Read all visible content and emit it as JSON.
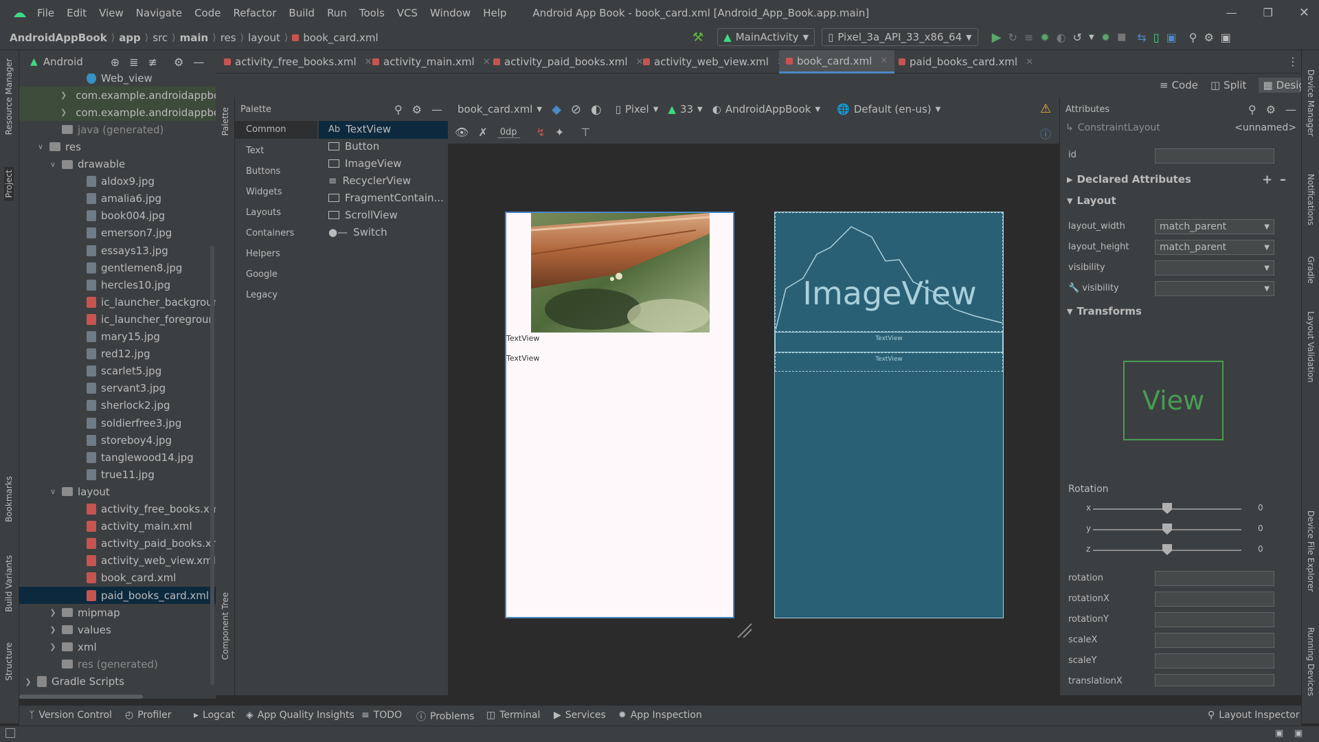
{
  "window": {
    "title": "Android App Book - book_card.xml [Android_App_Book.app.main]",
    "menu": [
      "File",
      "Edit",
      "View",
      "Navigate",
      "Code",
      "Refactor",
      "Build",
      "Run",
      "Tools",
      "VCS",
      "Window",
      "Help"
    ]
  },
  "breadcrumb": [
    "AndroidAppBook",
    "app",
    "src",
    "main",
    "res",
    "layout",
    "book_card.xml"
  ],
  "toolbar": {
    "run_config": "MainActivity",
    "device": "Pixel_3a_API_33_x86_64"
  },
  "project_panel": {
    "view_label": "Android",
    "tree": [
      {
        "label": "Web_view",
        "indent": 4,
        "kind": "class"
      },
      {
        "label": "com.example.androidappbo",
        "indent": 3,
        "kind": "package",
        "arrow": "right"
      },
      {
        "label": "com.example.androidappbo",
        "indent": 3,
        "kind": "package",
        "arrow": "right"
      },
      {
        "label": "java (generated)",
        "indent": 2,
        "kind": "folder-gen"
      },
      {
        "label": "res",
        "indent": 1,
        "kind": "folder",
        "arrow": "down"
      },
      {
        "label": "drawable",
        "indent": 2,
        "kind": "folder",
        "arrow": "down"
      },
      {
        "label": "aldox9.jpg",
        "indent": 4,
        "kind": "image"
      },
      {
        "label": "amalia6.jpg",
        "indent": 4,
        "kind": "image"
      },
      {
        "label": "book004.jpg",
        "indent": 4,
        "kind": "image"
      },
      {
        "label": "emerson7.jpg",
        "indent": 4,
        "kind": "image"
      },
      {
        "label": "essays13.jpg",
        "indent": 4,
        "kind": "image"
      },
      {
        "label": "gentlemen8.jpg",
        "indent": 4,
        "kind": "image"
      },
      {
        "label": "hercles10.jpg",
        "indent": 4,
        "kind": "image"
      },
      {
        "label": "ic_launcher_background.x",
        "indent": 4,
        "kind": "xml"
      },
      {
        "label": "ic_launcher_foreground.x",
        "indent": 4,
        "kind": "xml"
      },
      {
        "label": "mary15.jpg",
        "indent": 4,
        "kind": "image"
      },
      {
        "label": "red12.jpg",
        "indent": 4,
        "kind": "image"
      },
      {
        "label": "scarlet5.jpg",
        "indent": 4,
        "kind": "image"
      },
      {
        "label": "servant3.jpg",
        "indent": 4,
        "kind": "image"
      },
      {
        "label": "sherlock2.jpg",
        "indent": 4,
        "kind": "image"
      },
      {
        "label": "soldierfree3.jpg",
        "indent": 4,
        "kind": "image"
      },
      {
        "label": "storeboy4.jpg",
        "indent": 4,
        "kind": "image"
      },
      {
        "label": "tanglewood14.jpg",
        "indent": 4,
        "kind": "image"
      },
      {
        "label": "true11.jpg",
        "indent": 4,
        "kind": "image"
      },
      {
        "label": "layout",
        "indent": 2,
        "kind": "folder",
        "arrow": "down"
      },
      {
        "label": "activity_free_books.xml",
        "indent": 4,
        "kind": "xml"
      },
      {
        "label": "activity_main.xml",
        "indent": 4,
        "kind": "xml"
      },
      {
        "label": "activity_paid_books.xml",
        "indent": 4,
        "kind": "xml"
      },
      {
        "label": "activity_web_view.xml",
        "indent": 4,
        "kind": "xml"
      },
      {
        "label": "book_card.xml",
        "indent": 4,
        "kind": "xml"
      },
      {
        "label": "paid_books_card.xml",
        "indent": 4,
        "kind": "xml",
        "selected": true
      },
      {
        "label": "mipmap",
        "indent": 2,
        "kind": "folder",
        "arrow": "right"
      },
      {
        "label": "values",
        "indent": 2,
        "kind": "folder",
        "arrow": "right"
      },
      {
        "label": "xml",
        "indent": 2,
        "kind": "folder",
        "arrow": "right"
      },
      {
        "label": "res (generated)",
        "indent": 2,
        "kind": "folder-gen"
      },
      {
        "label": "Gradle Scripts",
        "indent": 0,
        "kind": "gradle",
        "arrow": "right"
      }
    ]
  },
  "left_stripe": [
    "Resource Manager",
    "Project",
    "Bookmarks",
    "Build Variants",
    "Structure"
  ],
  "right_stripe": [
    "Device Manager",
    "Notifications",
    "Gradle",
    "Layout Validation",
    "Device File Explorer",
    "Running Devices"
  ],
  "tabs": [
    {
      "label": "activity_free_books.xml"
    },
    {
      "label": "activity_main.xml"
    },
    {
      "label": "activity_paid_books.xml"
    },
    {
      "label": "activity_web_view.xml"
    },
    {
      "label": "book_card.xml",
      "active": true
    },
    {
      "label": "paid_books_card.xml"
    }
  ],
  "view_modes": [
    "Code",
    "Split",
    "Design"
  ],
  "palette": {
    "title": "Palette",
    "stripe_label": "Palette",
    "component_tree_label": "Component Tree",
    "categories": [
      "Common",
      "Text",
      "Buttons",
      "Widgets",
      "Layouts",
      "Containers",
      "Helpers",
      "Google",
      "Legacy"
    ],
    "items": [
      {
        "label": "TextView",
        "icon": "Ab"
      },
      {
        "label": "Button"
      },
      {
        "label": "ImageView"
      },
      {
        "label": "RecyclerView"
      },
      {
        "label": "FragmentContain..."
      },
      {
        "label": "ScrollView"
      },
      {
        "label": "Switch"
      }
    ]
  },
  "design_toolbar": {
    "file": "book_card.xml",
    "device": "Pixel",
    "api": "33",
    "theme": "AndroidAppBook",
    "locale": "Default (en-us)",
    "margin": "0dp"
  },
  "preview": {
    "textview1": "TextView",
    "textview2": "TextView",
    "blueprint_image_label": "ImageView",
    "blueprint_text1": "TextView",
    "blueprint_text2": "TextView"
  },
  "attributes": {
    "title": "Attributes",
    "component": "ConstraintLayout",
    "component_name": "<unnamed>",
    "id_label": "id",
    "declared": "Declared Attributes",
    "layout_section": "Layout",
    "layout_width_label": "layout_width",
    "layout_width": "match_parent",
    "layout_height_label": "layout_height",
    "layout_height": "match_parent",
    "visibility_label": "visibility",
    "visibility2_label": "visibility",
    "transforms": "Transforms",
    "view_label": "View",
    "rotation_label": "Rotation",
    "rot_x_label": "x",
    "rot_x": "0",
    "rot_y_label": "y",
    "rot_y": "0",
    "rot_z_label": "z",
    "rot_z": "0",
    "fields": [
      "rotation",
      "rotationX",
      "rotationY",
      "scaleX",
      "scaleY",
      "translationX"
    ]
  },
  "bottom_bar": [
    "Version Control",
    "Profiler",
    "Logcat",
    "App Quality Insights",
    "TODO",
    "Problems",
    "Terminal",
    "Services",
    "App Inspection"
  ],
  "layout_inspector": "Layout Inspector",
  "colors": {
    "accent": "#4a88c7",
    "blueprint": "#2a6075",
    "android_green": "#3ddc84"
  }
}
